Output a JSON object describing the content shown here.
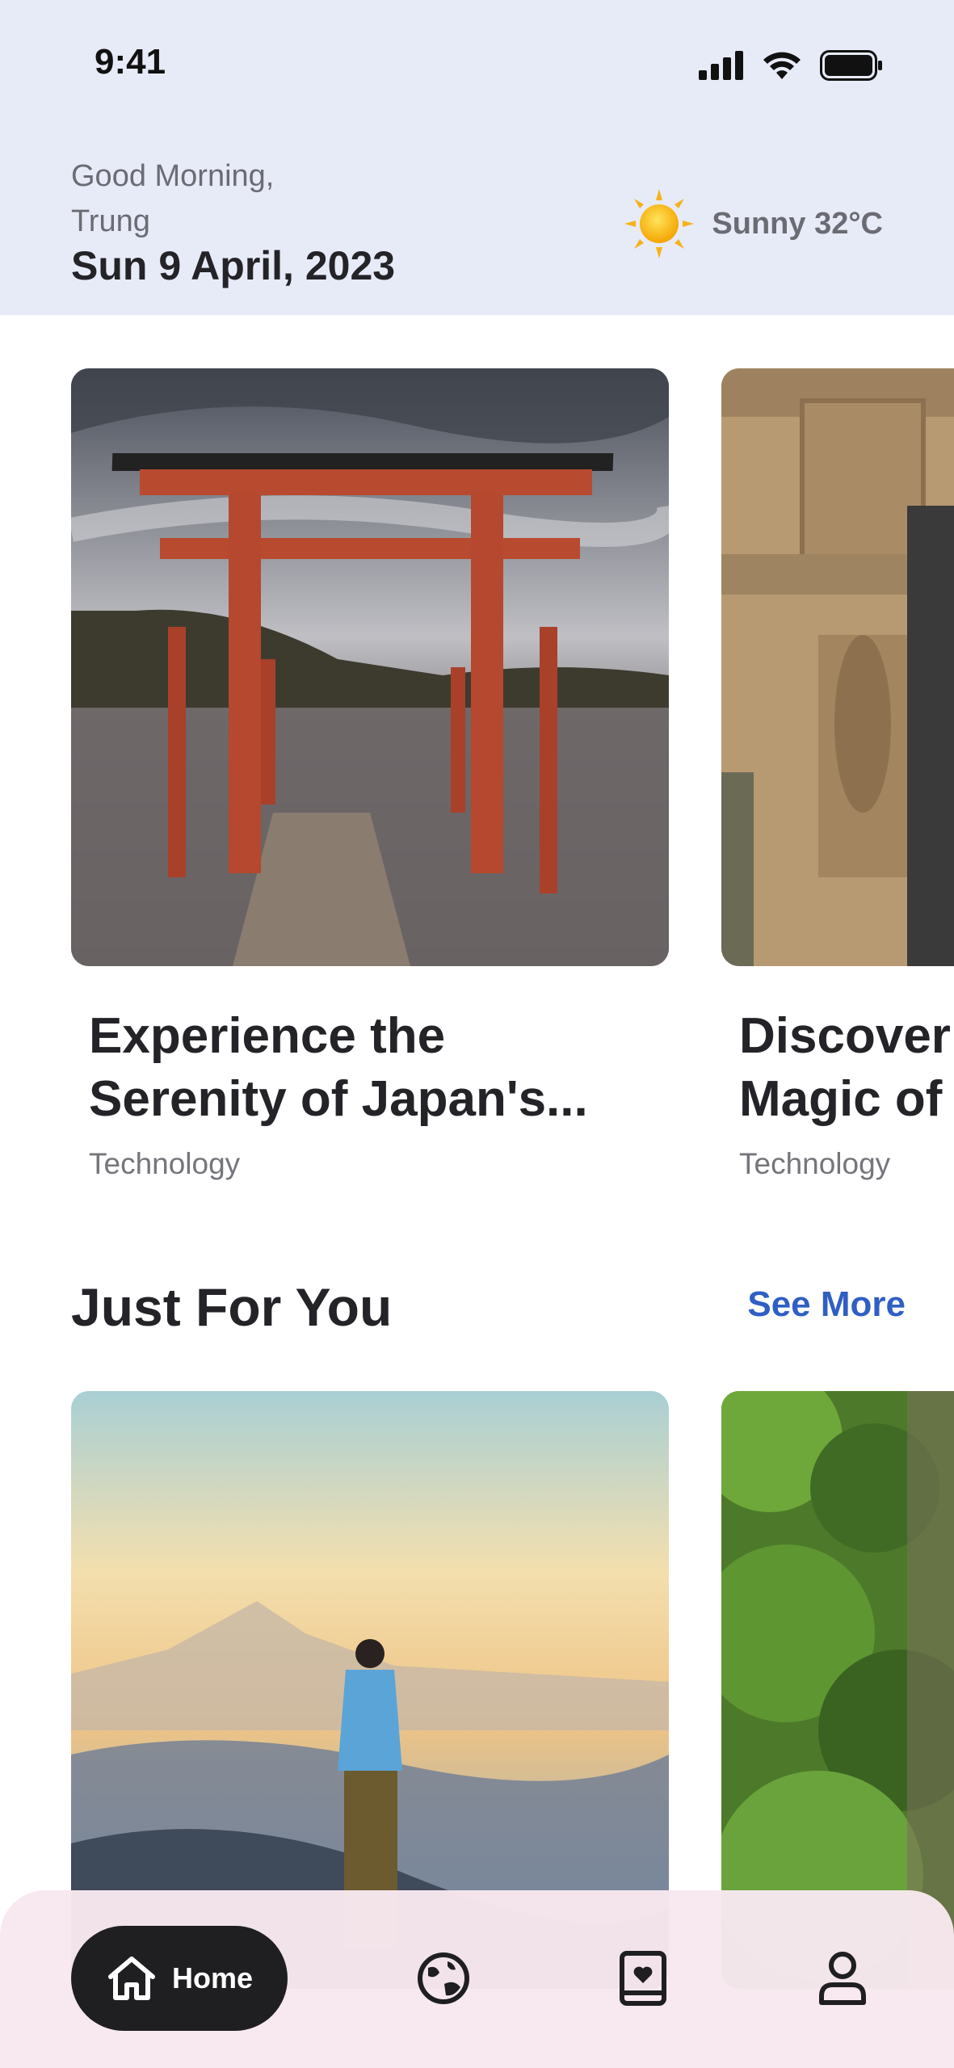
{
  "status": {
    "time": "9:41"
  },
  "header": {
    "greeting_line1": "Good Morning,",
    "greeting_line2": "Trung",
    "date": "Sun 9 April, 2023",
    "weather": "Sunny 32°C",
    "weather_icon": "sun-icon"
  },
  "featured": [
    {
      "title_line1": "Experience the",
      "title_line2": "Serenity of Japan's...",
      "category": "Technology"
    },
    {
      "title_line1": "Discover the",
      "title_line2": "Magic of Paris",
      "category": "Technology"
    }
  ],
  "just_for_you": {
    "title": "Just For You",
    "see_more": "See More"
  },
  "tabbar": {
    "home_label": "Home",
    "icons": [
      "home-icon",
      "globe-icon",
      "bookmark-book-icon",
      "profile-icon"
    ]
  },
  "colors": {
    "header_bg": "#e7ebf7",
    "accent": "#2f5fc4",
    "tab_active": "#1f1f22",
    "tab_bg": "#f8e8f0"
  }
}
